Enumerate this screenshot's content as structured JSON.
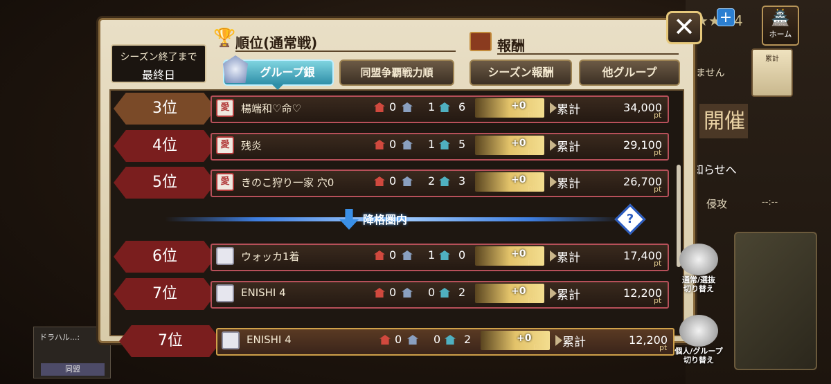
{
  "header": {
    "close_label": "✕",
    "home_label": "ホーム",
    "currency_stars": "★★ 24",
    "plus_label": "+"
  },
  "season": {
    "line1": "シーズン終了まで",
    "line2": "最終日"
  },
  "sections": {
    "rank_title": "順位(通常戦)",
    "reward_title": "報酬"
  },
  "tabs": [
    {
      "label": "グループ銀",
      "active": true
    },
    {
      "label": "同盟争覇戦力順",
      "active": false
    },
    {
      "label": "シーズン報酬",
      "active": false
    },
    {
      "label": "他グループ",
      "active": false
    }
  ],
  "rows": [
    {
      "rank": "3位",
      "emblem": "愛",
      "name": "楊端和♡命♡",
      "c1": "0",
      "c2": "1",
      "c3": "6",
      "pt": "+0",
      "pt_unit": "pt",
      "total_label": "累計",
      "total": "34,000",
      "total_unit": "pt"
    },
    {
      "rank": "4位",
      "emblem": "愛",
      "name": "残炎",
      "c1": "0",
      "c2": "1",
      "c3": "5",
      "pt": "+0",
      "pt_unit": "pt",
      "total_label": "累計",
      "total": "29,100",
      "total_unit": "pt"
    },
    {
      "rank": "5位",
      "emblem": "愛",
      "name": "きのこ狩り一家 穴0",
      "c1": "0",
      "c2": "2",
      "c3": "3",
      "pt": "+0",
      "pt_unit": "pt",
      "total_label": "累計",
      "total": "26,700",
      "total_unit": "pt"
    },
    {
      "rank": "6位",
      "emblem": "",
      "name": "ウォッカ1着",
      "c1": "0",
      "c2": "1",
      "c3": "0",
      "pt": "+0",
      "pt_unit": "pt",
      "total_label": "累計",
      "total": "17,400",
      "total_unit": "pt"
    },
    {
      "rank": "7位",
      "emblem": "",
      "name": "ENISHI 4",
      "c1": "0",
      "c2": "0",
      "c3": "2",
      "pt": "+0",
      "pt_unit": "pt",
      "total_label": "累計",
      "total": "12,200",
      "total_unit": "pt"
    }
  ],
  "my_row": {
    "rank": "7位",
    "emblem": "",
    "name": "ENISHI 4",
    "c1": "0",
    "c2": "0",
    "c3": "2",
    "pt": "+0",
    "pt_unit": "pt",
    "total_label": "累計",
    "total": "12,200",
    "total_unit": "pt"
  },
  "demotion": {
    "label": "降格圏内",
    "help": "?"
  },
  "switches": [
    {
      "label_1": "通常/選抜",
      "label_2": "切り替え"
    },
    {
      "label_1": "個人/グループ",
      "label_2": "切り替え"
    }
  ],
  "background": {
    "kaisai": "開催",
    "oshirase": "知らせへ",
    "shinko": "侵攻",
    "time": "--:--",
    "misc_text": "ません",
    "scroll_text": "累計",
    "left_name": "ドラハル...:",
    "left_button": "同盟"
  }
}
